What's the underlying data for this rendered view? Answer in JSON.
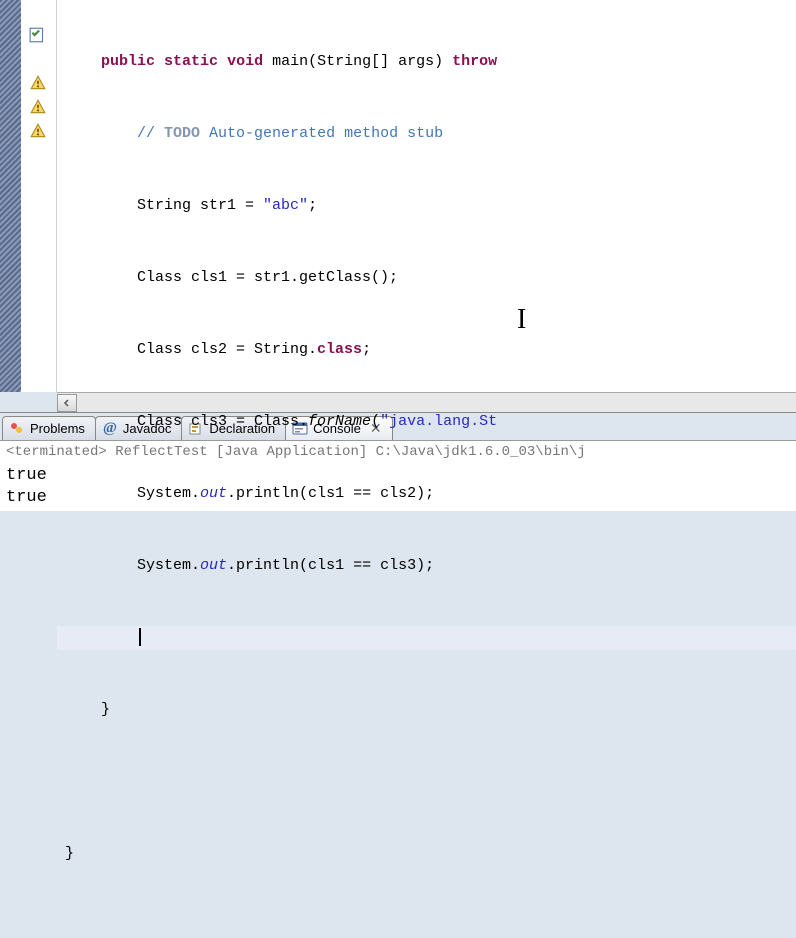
{
  "code": {
    "line1_pre": "    ",
    "line1_kw1": "public",
    "line1_sp1": " ",
    "line1_kw2": "static",
    "line1_sp2": " ",
    "line1_kw3": "void",
    "line1_sp3": " ",
    "line1_main": "main(String[] args) ",
    "line1_kw4": "throw",
    "line2_pre": "        ",
    "line2_com": "// ",
    "line2_todo": "TODO",
    "line2_rest": " Auto-generated method stub",
    "line3": "        String str1 = ",
    "line3_str": "\"abc\"",
    "line3_end": ";",
    "line4": "        Class cls1 = str1.getClass();",
    "line5_pre": "        Class cls2 = String.",
    "line5_kw": "class",
    "line5_end": ";",
    "line6_pre": "        Class cls3 = Class.",
    "line6_method": "forName",
    "line6_paren": "(",
    "line6_str": "\"java.lang.St",
    "line7_pre": "        System.",
    "line7_out": "out",
    "line7_rest": ".println(cls1 == cls2);",
    "line8_pre": "        System.",
    "line8_out": "out",
    "line8_rest": ".println(cls1 == cls3);",
    "line10": "    }",
    "line12": "}"
  },
  "tabs": {
    "problems": "Problems",
    "javadoc": "Javadoc",
    "declaration": "Declaration",
    "console": "Console"
  },
  "console": {
    "status": "<terminated> ReflectTest [Java Application] C:\\Java\\jdk1.6.0_03\\bin\\j",
    "output1": "true",
    "output2": "true"
  },
  "icons": {
    "at": "@",
    "close": "✕"
  }
}
